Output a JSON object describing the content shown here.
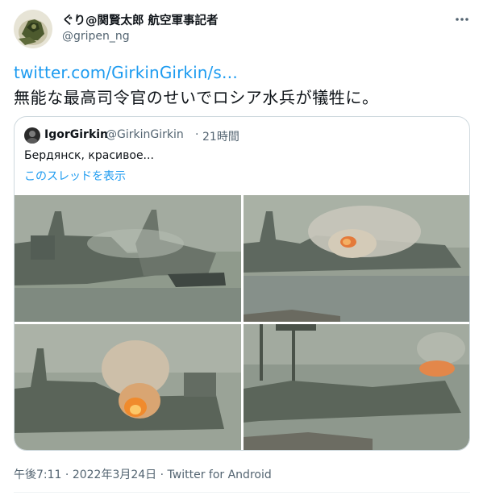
{
  "author": {
    "name": "ぐり@関賢太郎 航空軍事記者",
    "handle": "@gripen_ng",
    "avatar_icon": "avatar-icon"
  },
  "tweet": {
    "link": "twitter.com/GirkinGirkin/s…",
    "text": "無能な最高司令官のせいでロシア水兵が犠牲に。"
  },
  "quoted": {
    "name": "IgorGirkin",
    "handle": "@GirkinGirkin",
    "separator": "·",
    "time": "21時間",
    "text": "Бердянск, красивое...",
    "show_thread": "このスレッドを表示"
  },
  "footer": {
    "time": "午後7:11",
    "date": "2022年3月24日",
    "source": "Twitter for Android",
    "separator": "·"
  },
  "colors": {
    "accent": "#1d9bf0",
    "text": "#0f1419",
    "secondary": "#536471",
    "border": "#cfd9de"
  },
  "icons": {
    "more": "more-horizontal-icon"
  }
}
